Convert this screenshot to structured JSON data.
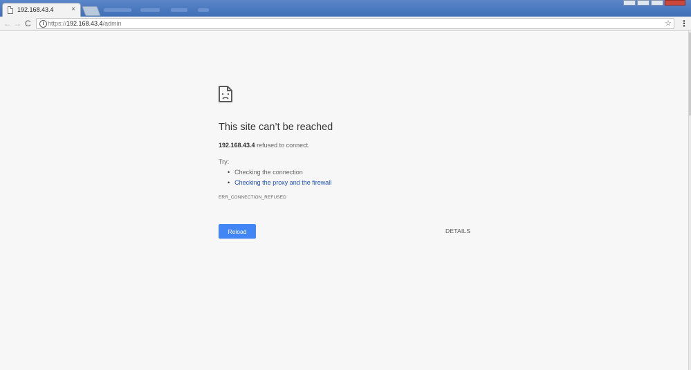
{
  "tab": {
    "title": "192.168.43.4",
    "close": "×"
  },
  "toolbar": {
    "back": "←",
    "forward": "→",
    "reload": "C",
    "url_prefix": "https://",
    "url_host": "192.168.43.4",
    "url_path": "/admin",
    "star": "☆",
    "menu": "⋮"
  },
  "error": {
    "title": "This site can’t be reached",
    "host": "192.168.43.4",
    "message": " refused to connect.",
    "try_label": "Try:",
    "suggestions": [
      "Checking the connection",
      "Checking the proxy and the firewall"
    ],
    "code": "ERR_CONNECTION_REFUSED"
  },
  "buttons": {
    "reload": "Reload",
    "details": "DETAILS"
  },
  "colors": {
    "link": "#1a4fb6",
    "reload_button": "#4285f4"
  }
}
